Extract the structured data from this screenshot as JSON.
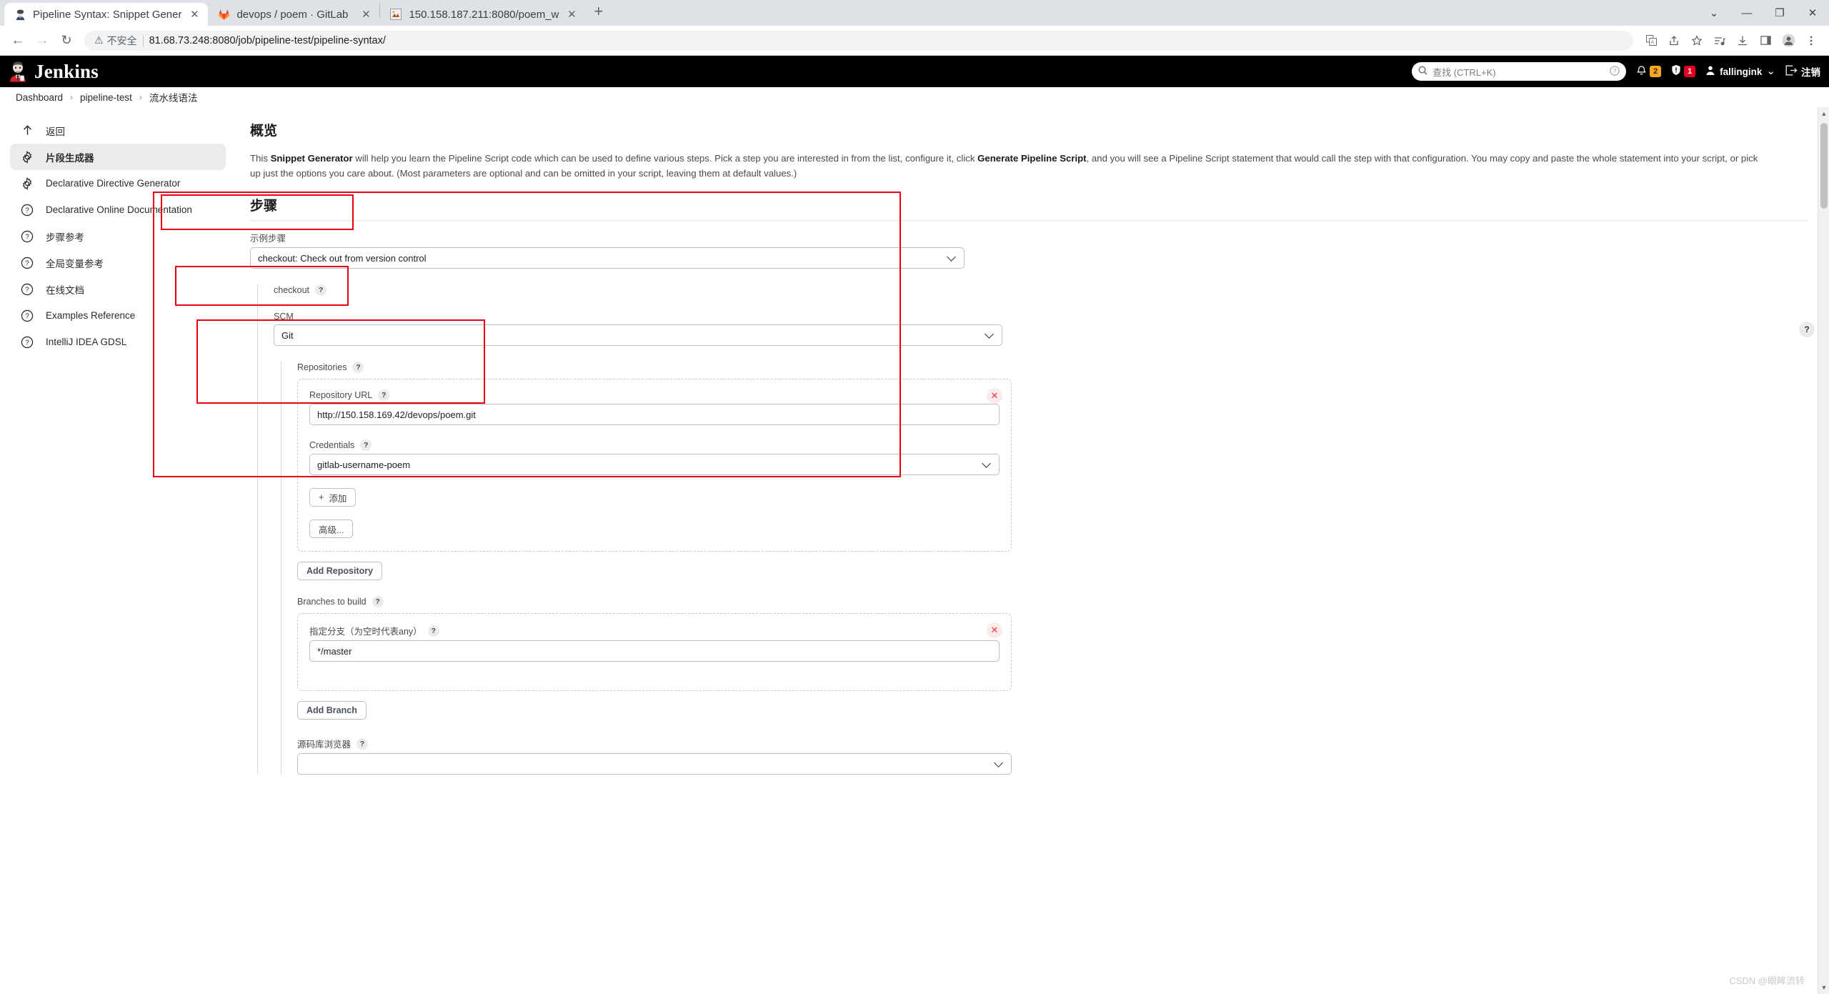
{
  "browser": {
    "tabs": [
      {
        "title": "Pipeline Syntax: Snippet Gener",
        "favicon": "jenkins-icon",
        "active": true,
        "close_label": "✕"
      },
      {
        "title": "devops / poem · GitLab",
        "favicon": "gitlab-icon",
        "active": false,
        "close_label": "✕"
      },
      {
        "title": "150.158.187.211:8080/poem_w",
        "favicon": "generic-site-icon",
        "active": false,
        "close_label": "✕"
      }
    ],
    "new_tab_label": "+",
    "window_controls": {
      "collapse": "⌄",
      "minimize": "—",
      "maximize": "❐",
      "close": "✕"
    },
    "nav": {
      "back": "←",
      "forward": "→",
      "reload": "↻"
    },
    "omnibox": {
      "security_label": "不安全",
      "warning_icon": "warning-triangle-icon",
      "url": "81.68.73.248:8080/job/pipeline-test/pipeline-syntax/"
    },
    "toolbar_icons": [
      "translate-icon",
      "share-icon",
      "bookmark-star-icon",
      "media-list-icon",
      "download-icon",
      "sidebar-panel-icon",
      "profile-avatar-icon",
      "kebab-menu-icon"
    ]
  },
  "jenkins_header": {
    "wordmark": "Jenkins",
    "search": {
      "placeholder": "查找 (CTRL+K)",
      "icon": "search-icon",
      "help_icon": "question-circle-icon"
    },
    "notifications": {
      "icon": "bell-icon",
      "count": "2",
      "color": "#f5a623"
    },
    "security": {
      "icon": "shield-icon",
      "count": "1",
      "color": "#e6001f"
    },
    "user": {
      "name": "fallingink",
      "icon": "person-icon",
      "chevron": "⌄"
    },
    "logout": {
      "label": "注销",
      "icon": "logout-icon"
    }
  },
  "breadcrumb": {
    "items": [
      "Dashboard",
      "pipeline-test",
      "流水线语法"
    ],
    "separator": "›"
  },
  "sidebar": {
    "items": [
      {
        "label": "返回",
        "icon": "arrow-up-icon",
        "active": false
      },
      {
        "label": "片段生成器",
        "icon": "gear-icon",
        "active": true
      },
      {
        "label": "Declarative Directive Generator",
        "icon": "gear-icon",
        "active": false
      },
      {
        "label": "Declarative Online Documentation",
        "icon": "question-icon",
        "active": false
      },
      {
        "label": "步骤参考",
        "icon": "question-icon",
        "active": false
      },
      {
        "label": "全局变量参考",
        "icon": "question-icon",
        "active": false
      },
      {
        "label": "在线文档",
        "icon": "question-icon",
        "active": false
      },
      {
        "label": "Examples Reference",
        "icon": "question-icon",
        "active": false
      },
      {
        "label": "IntelliJ IDEA GDSL",
        "icon": "question-icon",
        "active": false
      }
    ]
  },
  "overview": {
    "title": "概览",
    "text_part1": "This ",
    "bold1": "Snippet Generator",
    "text_part2": " will help you learn the Pipeline Script code which can be used to define various steps. Pick a step you are interested in from the list, configure it, click ",
    "bold2": "Generate Pipeline Script",
    "text_part3": ", and you will see a Pipeline Script statement that would call the step with that configuration. You may copy and paste the whole statement into your script, or pick up just the options you care about. (Most parameters are optional and can be omitted in your script, leaving them at default values.)"
  },
  "steps": {
    "title": "步骤",
    "sample_step": {
      "label": "示例步骤",
      "value": "checkout: Check out from version control"
    },
    "checkout": {
      "label": "checkout",
      "help": "?"
    },
    "scm": {
      "label": "SCM",
      "value": "Git"
    },
    "repositories": {
      "label": "Repositories",
      "help": "?",
      "repository_url": {
        "label": "Repository URL",
        "help": "?",
        "value": "http://150.158.169.42/devops/poem.git"
      },
      "credentials": {
        "label": "Credentials",
        "help": "?",
        "value": "gitlab-username-poem"
      },
      "add_button": "添加",
      "add_icon": "plus-icon",
      "advanced_button": "高级...",
      "delete_icon": "✕"
    },
    "add_repository_button": "Add Repository",
    "branches": {
      "label": "Branches to build",
      "help": "?",
      "branch_specifier": {
        "label": "指定分支（为空时代表any）",
        "help": "?",
        "value": "*/master"
      },
      "delete_icon": "✕"
    },
    "add_branch_button": "Add Branch",
    "source_browser": {
      "label": "源码库浏览器",
      "help": "?"
    },
    "page_help_icon": "?"
  },
  "watermark": "CSDN @眼眸流转"
}
